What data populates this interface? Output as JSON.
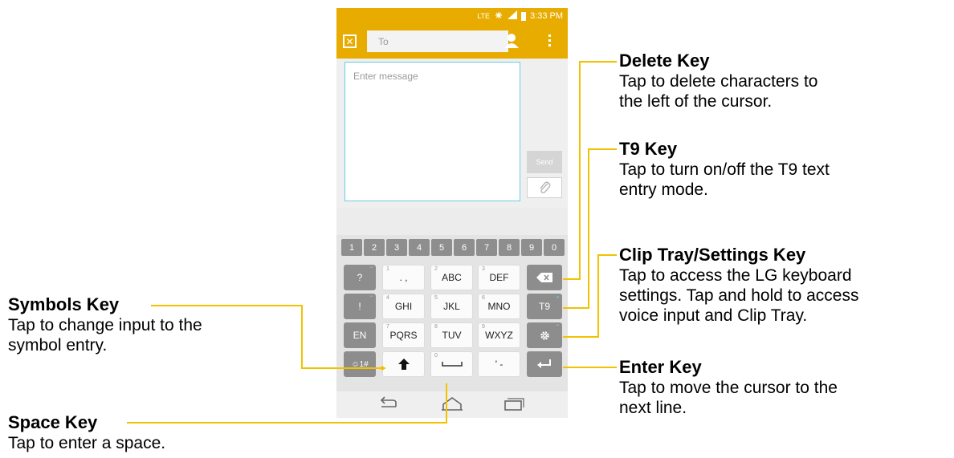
{
  "status_bar": {
    "network": "LTE",
    "time": "3:33 PM"
  },
  "app_bar": {
    "to_placeholder": "To"
  },
  "compose": {
    "message_placeholder": "Enter message",
    "send_label": "Send"
  },
  "keyboard": {
    "number_row": [
      "1",
      "2",
      "3",
      "4",
      "5",
      "6",
      "7",
      "8",
      "9",
      "0"
    ],
    "rows": [
      {
        "symbol_label": "?",
        "k1": ". ,",
        "k1_num": "1",
        "k2": "ABC",
        "k2_num": "2",
        "k3": "DEF",
        "k3_num": "3"
      },
      {
        "symbol_label": "!",
        "k1": "GHI",
        "k1_num": "4",
        "k2": "JKL",
        "k2_num": "5",
        "k3": "MNO",
        "k3_num": "6",
        "t9_label": "T9"
      },
      {
        "lang_label": "EN",
        "k1": "PQRS",
        "k1_num": "7",
        "k2": "TUV",
        "k2_num": "8",
        "k3": "WXYZ",
        "k3_num": "9"
      },
      {
        "sym_label": "☺1#",
        "k2_num": "0",
        "k3": "' -"
      }
    ]
  },
  "callouts": {
    "delete": {
      "title": "Delete Key",
      "desc1": "Tap to delete characters to",
      "desc2": "the left of the cursor."
    },
    "t9": {
      "title": "T9 Key",
      "desc1": "Tap to turn on/off the T9 text",
      "desc2": "entry mode."
    },
    "clip": {
      "title": "Clip Tray/Settings Key",
      "desc1": "Tap to access the LG keyboard",
      "desc2": "settings. Tap and hold to access",
      "desc3": "voice input and Clip Tray."
    },
    "enter": {
      "title": "Enter Key",
      "desc1": "Tap to move the cursor to the",
      "desc2": "next line."
    },
    "symbols": {
      "title": "Symbols Key",
      "desc1": "Tap to change input to the",
      "desc2": "symbol entry."
    },
    "space": {
      "title": "Space Key",
      "desc1": "Tap to enter a space."
    }
  },
  "colors": {
    "accent": "#e8ac00",
    "callout_line": "#f2c200",
    "input_border": "#66cfe0",
    "key_dark": "#8d8d8d"
  }
}
